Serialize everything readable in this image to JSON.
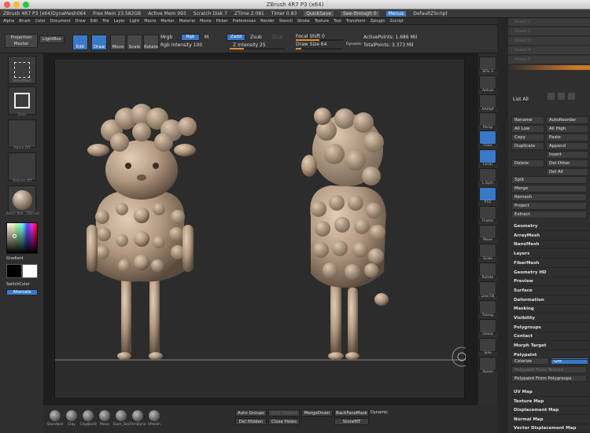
{
  "window": {
    "title": "ZBrush 4R7 P3 (x64)"
  },
  "status": {
    "doc": "ZBrush 4R7 P3 (x64)DynaMesh064",
    "free_mem": "Free Mem 23.582GB",
    "active_mem": "Active Mem 993",
    "scratch": "Scratch Disk 7",
    "ztime": "ZTime 2.081",
    "timer": "Timer 0.83",
    "quicksave": "QuickSave",
    "seethrough": "See-through 0",
    "menus": "Menus",
    "script": "DefaultZScript"
  },
  "menus": [
    "Alpha",
    "Brush",
    "Color",
    "Document",
    "Draw",
    "Edit",
    "File",
    "Layer",
    "Light",
    "Macro",
    "Marker",
    "Material",
    "Movie",
    "Picker",
    "Preferences",
    "Render",
    "Stencil",
    "Stroke",
    "Texture",
    "Tool",
    "Transform",
    "Zplugin",
    "Zscript"
  ],
  "toolbar": {
    "projection_master": "Projection Master",
    "lightbox": "LightBox",
    "edit": "Edit",
    "draw": "Draw",
    "move": "Move",
    "scale": "Scale",
    "rotate": "Rotate",
    "mrgb": "Mrgb",
    "rgb": "Rgb",
    "m": "M",
    "rgb_intensity": "Rgb Intensity 100",
    "zadd": "Zadd",
    "zsub": "Zsub",
    "zcut": "Zcut",
    "z_intensity": "Z Intensity 25",
    "focal_shift": "Focal Shift 0",
    "draw_size": "Draw Size 64",
    "dynamic": "Dynamic",
    "active_points": "ActivePoints: 1.686 Mil",
    "total_points": "TotalPoints: 3.373 Mil"
  },
  "left_tray": {
    "brush_label": "SelectRect",
    "stroke_label": "Dots",
    "alpha_label": "Alpha Off",
    "texture_label": "Texture Off",
    "material_label": "Basic Mat...ZBrush",
    "gradient": "Gradient",
    "switchcolor": "SwitchColor",
    "alternate": "Alternate"
  },
  "shelf": [
    "SPix 3",
    "Actual",
    "AAHalf",
    "Persp",
    "Floor",
    "Local",
    "L.Sym",
    "XYZ",
    "Frame",
    "Move",
    "Scale",
    "Rotate",
    "Line Fill",
    "Transp",
    "Ghost",
    "Solo",
    "Xpose"
  ],
  "right_panel": {
    "history": [
      "Sheed 1",
      "Sheed 2",
      "Sheed 3",
      "Sheed 4",
      "Sheed 5"
    ],
    "list_all": "List All",
    "subtool_buttons": [
      [
        "Rename",
        "AutoReorder"
      ],
      [
        "All Low",
        "All High"
      ],
      [
        "Copy",
        "Paste"
      ],
      [
        "Duplicate",
        "Append"
      ],
      [
        "",
        "Insert"
      ],
      [
        "Delete",
        "Del Other"
      ],
      [
        "",
        "Del All"
      ]
    ],
    "actions": [
      "Split",
      "Merge",
      "Remesh",
      "Project",
      "Extract"
    ],
    "subpalettes": [
      "Geometry",
      "ArrayMesh",
      "NanoMesh",
      "Layers",
      "FiberMesh",
      "Geometry HD",
      "Preview",
      "Surface",
      "Deformation",
      "Masking",
      "Visibility",
      "Polygroups",
      "Contact",
      "Morph Target",
      "Polypaint"
    ],
    "colorize": "Colorize",
    "grd": "Grd",
    "pp_texture": "Polypaint From Texture",
    "pp_polygroups": "Polypaint From Polygroups",
    "lower": [
      "UV Map",
      "Texture Map",
      "Displacement Map",
      "Normal Map",
      "Vector Displacement Map"
    ]
  },
  "bottom": {
    "brushes": [
      "Standard",
      "Clay",
      "ClayBuild",
      "Move",
      "Dam_Sta",
      "TrimDyna",
      "hPolish"
    ],
    "auto_groups": "Auto Groups",
    "split_hidden": "Split Hidden",
    "merge_down": "MergeDown",
    "backface": "BackFaceMask",
    "dynamic": "Dynamic",
    "del_hidden": "Del Hidden",
    "close_holes": "Close Holes",
    "store_mt": "StoreMT"
  },
  "colors": {
    "accent": "#3a78c8",
    "slider": "#e28a2b",
    "clay": "#b49a82"
  }
}
